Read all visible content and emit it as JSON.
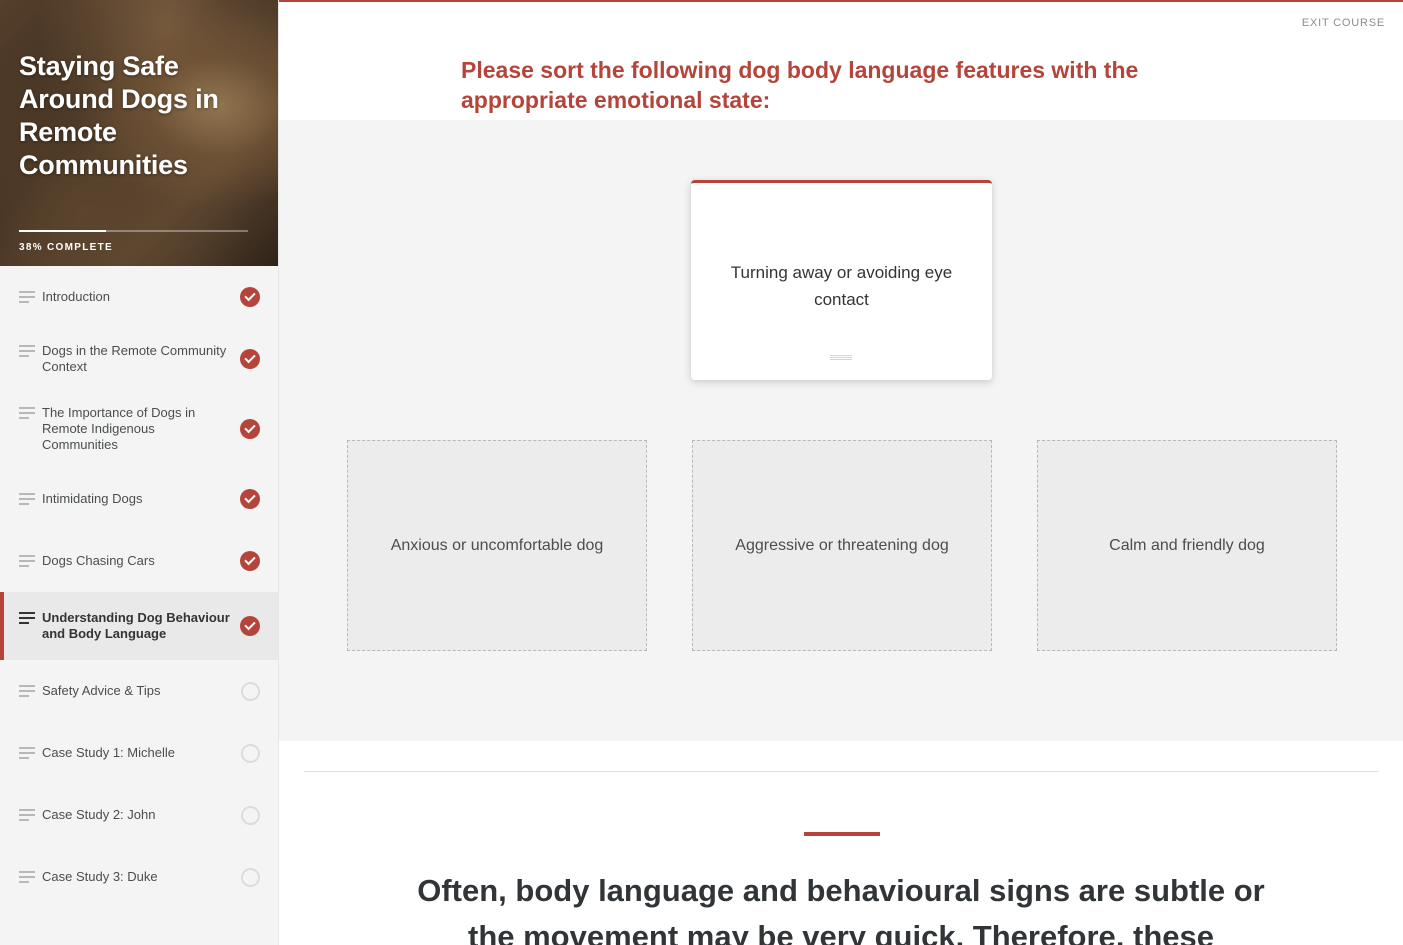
{
  "course": {
    "title": "Staying Safe Around Dogs in Remote Communities",
    "progress_label": "38% COMPLETE",
    "progress_fraction": 0.38
  },
  "sidebar": {
    "items": [
      {
        "label": "Introduction",
        "status": "complete"
      },
      {
        "label": "Dogs in the Remote Community Context",
        "status": "complete"
      },
      {
        "label": "The Importance of Dogs in Remote Indigenous Communities",
        "status": "complete"
      },
      {
        "label": "Intimidating Dogs",
        "status": "complete"
      },
      {
        "label": "Dogs Chasing Cars",
        "status": "complete"
      },
      {
        "label": "Understanding Dog Behaviour and Body Language",
        "status": "complete",
        "active": true
      },
      {
        "label": "Safety Advice & Tips",
        "status": "incomplete"
      },
      {
        "label": "Case Study 1: Michelle",
        "status": "incomplete"
      },
      {
        "label": "Case Study 2: John",
        "status": "incomplete"
      },
      {
        "label": "Case Study 3: Duke",
        "status": "incomplete"
      }
    ]
  },
  "header": {
    "exit_label": "EXIT COURSE"
  },
  "activity": {
    "question": "Please sort the following dog body language features with the appropriate emotional state:",
    "card_text": "Turning away or avoiding eye contact",
    "dropzones": [
      {
        "label": "Anxious or uncomfortable dog"
      },
      {
        "label": "Aggressive or threatening dog"
      },
      {
        "label": "Calm and friendly dog"
      }
    ]
  },
  "content": {
    "statement": "Often, body language and behavioural signs are subtle or the movement may be very quick. Therefore, these"
  },
  "colors": {
    "accent": "#b5443a",
    "sidebar_bg": "#f4f4f4",
    "text": "#313537"
  }
}
